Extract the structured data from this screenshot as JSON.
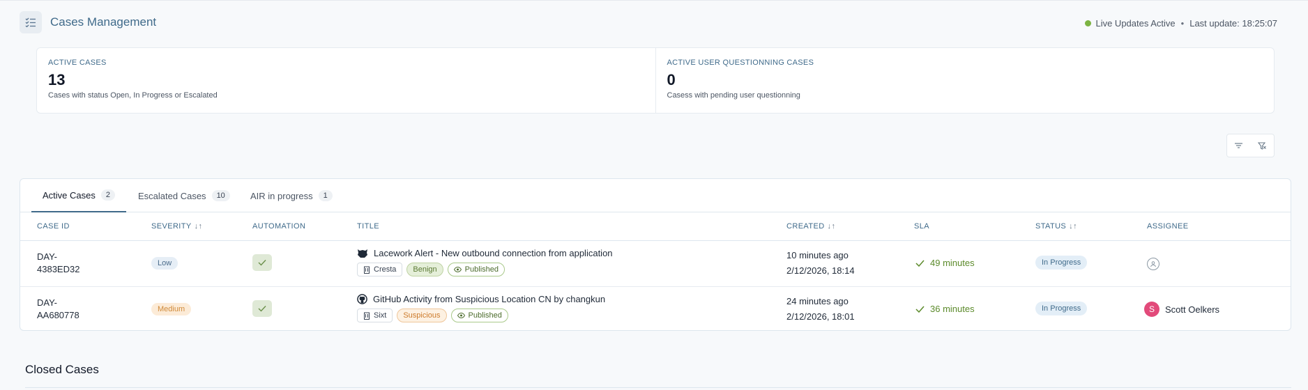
{
  "header": {
    "title": "Cases Management",
    "live_status": "Live Updates Active",
    "separator": "•",
    "last_update": "Last update: 18:25:07",
    "live_color": "#7cb342"
  },
  "stats": [
    {
      "label": "ACTIVE CASES",
      "value": "13",
      "desc": "Cases with status Open, In Progress or Escalated"
    },
    {
      "label": "ACTIVE USER QUESTIONNING CASES",
      "value": "0",
      "desc": "Casess with pending user questionning"
    }
  ],
  "tabs": [
    {
      "label": "Active Cases",
      "count": "2"
    },
    {
      "label": "Escalated Cases",
      "count": "10"
    },
    {
      "label": "AIR in progress",
      "count": "1"
    }
  ],
  "columns": {
    "case_id": "CASE ID",
    "severity": "SEVERITY",
    "automation": "AUTOMATION",
    "title": "TITLE",
    "created": "CREATED",
    "sla": "SLA",
    "status": "STATUS",
    "assignee": "ASSIGNEE",
    "sort_glyph": "↓↑"
  },
  "rows": [
    {
      "case_id_1": "DAY-",
      "case_id_2": "4383ED32",
      "severity": "Low",
      "title": "Lacework Alert - New outbound connection from application",
      "source_icon": "lacework-icon",
      "org": "Cresta",
      "verdict": "Benign",
      "visibility": "Published",
      "created_rel": "10 minutes ago",
      "created_abs": "2/12/2026, 18:14",
      "sla": "49 minutes",
      "status": "In Progress",
      "assignee": ""
    },
    {
      "case_id_1": "DAY-",
      "case_id_2": "AA680778",
      "severity": "Medium",
      "title": "GitHub Activity from Suspicious Location CN by changkun",
      "source_icon": "github-icon",
      "org": "Sixt",
      "verdict": "Suspicious",
      "visibility": "Published",
      "created_rel": "24 minutes ago",
      "created_abs": "2/12/2026, 18:01",
      "sla": "36 minutes",
      "status": "In Progress",
      "assignee": "Scott Oelkers",
      "assignee_initial": "S"
    }
  ],
  "closed": {
    "title": "Closed Cases"
  }
}
